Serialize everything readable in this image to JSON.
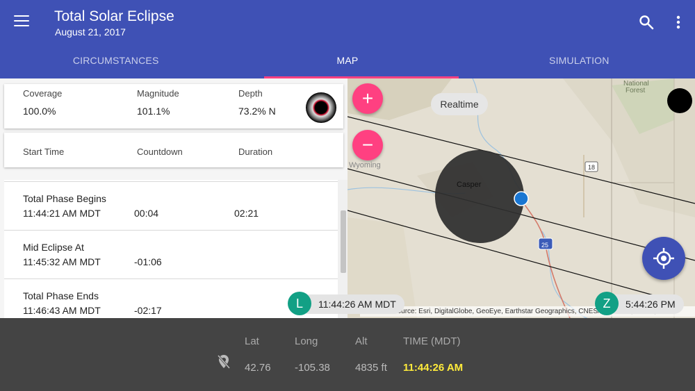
{
  "header": {
    "title": "Total Solar Eclipse",
    "subtitle": "August 21, 2017",
    "icons": {
      "menu": "menu-icon",
      "search": "search-icon",
      "more": "more-vert-icon"
    }
  },
  "tabs": [
    {
      "label": "CIRCUMSTANCES",
      "active": false
    },
    {
      "label": "MAP",
      "active": true
    },
    {
      "label": "SIMULATION",
      "active": false
    }
  ],
  "summary": {
    "coverage_label": "Coverage",
    "coverage_value": "100.0%",
    "magnitude_label": "Magnitude",
    "magnitude_value": "101.1%",
    "depth_label": "Depth",
    "depth_value": "73.2% N"
  },
  "timing_header": {
    "start_label": "Start Time",
    "countdown_label": "Countdown",
    "duration_label": "Duration"
  },
  "events": [
    {
      "label": "Total Phase Begins",
      "time": "11:44:21 AM MDT",
      "countdown": "00:04",
      "duration": "02:21"
    },
    {
      "label": "Mid Eclipse At",
      "time": "11:45:32 AM MDT",
      "countdown": "-01:06",
      "duration": ""
    },
    {
      "label": "Total Phase Ends",
      "time": "11:46:43 AM MDT",
      "countdown": "-02:17",
      "duration": ""
    }
  ],
  "map": {
    "zoom_in": "+",
    "zoom_out": "−",
    "realtime_label": "Realtime",
    "place_labels": {
      "forest": "National Forest",
      "state": "Wyoming",
      "city": "Casper",
      "route_18": "18",
      "route_25": "25"
    },
    "attribution": "© Esri — Source: Esri, DigitalGlobe, GeoEye, Earthstar Geographics, CNES/Airbus DS, USDA, USGS",
    "local_badge": "L",
    "local_time": "11:44:26 AM MDT",
    "zulu_badge": "Z",
    "zulu_time": "5:44:26 PM",
    "colors": {
      "shadow": "#2e2e2e",
      "marker": "#1976d2"
    }
  },
  "status": {
    "lat_label": "Lat",
    "lat_value": "42.76",
    "long_label": "Long",
    "long_value": "-105.38",
    "alt_label": "Alt",
    "alt_value": "4835 ft",
    "time_label": "TIME (MDT)",
    "time_value": "11:44:26 AM",
    "time_color": "#ffeb3b",
    "location_icon": "location-off-icon"
  }
}
